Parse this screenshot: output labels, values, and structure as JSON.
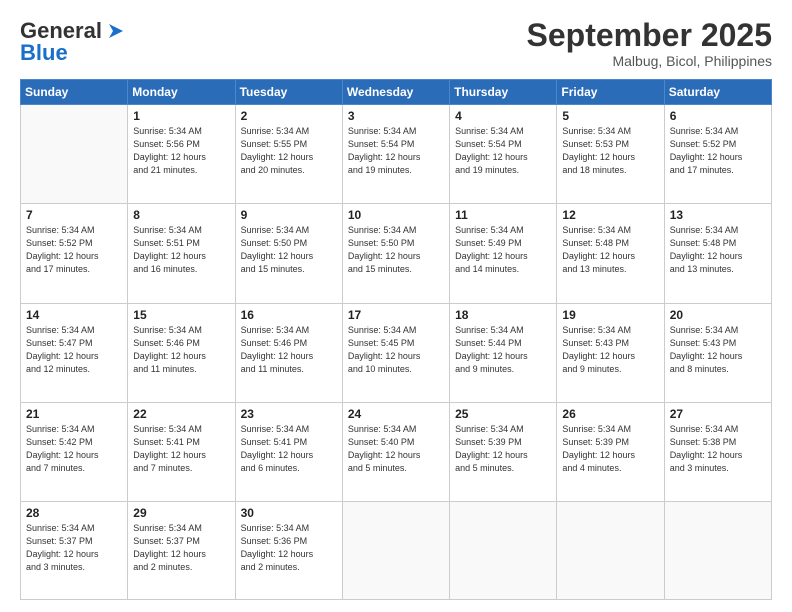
{
  "header": {
    "logo": {
      "general": "General",
      "blue": "Blue"
    },
    "title": "September 2025",
    "location": "Malbug, Bicol, Philippines"
  },
  "weekdays": [
    "Sunday",
    "Monday",
    "Tuesday",
    "Wednesday",
    "Thursday",
    "Friday",
    "Saturday"
  ],
  "weeks": [
    [
      {
        "day": "",
        "info": ""
      },
      {
        "day": "1",
        "info": "Sunrise: 5:34 AM\nSunset: 5:56 PM\nDaylight: 12 hours\nand 21 minutes."
      },
      {
        "day": "2",
        "info": "Sunrise: 5:34 AM\nSunset: 5:55 PM\nDaylight: 12 hours\nand 20 minutes."
      },
      {
        "day": "3",
        "info": "Sunrise: 5:34 AM\nSunset: 5:54 PM\nDaylight: 12 hours\nand 19 minutes."
      },
      {
        "day": "4",
        "info": "Sunrise: 5:34 AM\nSunset: 5:54 PM\nDaylight: 12 hours\nand 19 minutes."
      },
      {
        "day": "5",
        "info": "Sunrise: 5:34 AM\nSunset: 5:53 PM\nDaylight: 12 hours\nand 18 minutes."
      },
      {
        "day": "6",
        "info": "Sunrise: 5:34 AM\nSunset: 5:52 PM\nDaylight: 12 hours\nand 17 minutes."
      }
    ],
    [
      {
        "day": "7",
        "info": "Sunrise: 5:34 AM\nSunset: 5:52 PM\nDaylight: 12 hours\nand 17 minutes."
      },
      {
        "day": "8",
        "info": "Sunrise: 5:34 AM\nSunset: 5:51 PM\nDaylight: 12 hours\nand 16 minutes."
      },
      {
        "day": "9",
        "info": "Sunrise: 5:34 AM\nSunset: 5:50 PM\nDaylight: 12 hours\nand 15 minutes."
      },
      {
        "day": "10",
        "info": "Sunrise: 5:34 AM\nSunset: 5:50 PM\nDaylight: 12 hours\nand 15 minutes."
      },
      {
        "day": "11",
        "info": "Sunrise: 5:34 AM\nSunset: 5:49 PM\nDaylight: 12 hours\nand 14 minutes."
      },
      {
        "day": "12",
        "info": "Sunrise: 5:34 AM\nSunset: 5:48 PM\nDaylight: 12 hours\nand 13 minutes."
      },
      {
        "day": "13",
        "info": "Sunrise: 5:34 AM\nSunset: 5:48 PM\nDaylight: 12 hours\nand 13 minutes."
      }
    ],
    [
      {
        "day": "14",
        "info": "Sunrise: 5:34 AM\nSunset: 5:47 PM\nDaylight: 12 hours\nand 12 minutes."
      },
      {
        "day": "15",
        "info": "Sunrise: 5:34 AM\nSunset: 5:46 PM\nDaylight: 12 hours\nand 11 minutes."
      },
      {
        "day": "16",
        "info": "Sunrise: 5:34 AM\nSunset: 5:46 PM\nDaylight: 12 hours\nand 11 minutes."
      },
      {
        "day": "17",
        "info": "Sunrise: 5:34 AM\nSunset: 5:45 PM\nDaylight: 12 hours\nand 10 minutes."
      },
      {
        "day": "18",
        "info": "Sunrise: 5:34 AM\nSunset: 5:44 PM\nDaylight: 12 hours\nand 9 minutes."
      },
      {
        "day": "19",
        "info": "Sunrise: 5:34 AM\nSunset: 5:43 PM\nDaylight: 12 hours\nand 9 minutes."
      },
      {
        "day": "20",
        "info": "Sunrise: 5:34 AM\nSunset: 5:43 PM\nDaylight: 12 hours\nand 8 minutes."
      }
    ],
    [
      {
        "day": "21",
        "info": "Sunrise: 5:34 AM\nSunset: 5:42 PM\nDaylight: 12 hours\nand 7 minutes."
      },
      {
        "day": "22",
        "info": "Sunrise: 5:34 AM\nSunset: 5:41 PM\nDaylight: 12 hours\nand 7 minutes."
      },
      {
        "day": "23",
        "info": "Sunrise: 5:34 AM\nSunset: 5:41 PM\nDaylight: 12 hours\nand 6 minutes."
      },
      {
        "day": "24",
        "info": "Sunrise: 5:34 AM\nSunset: 5:40 PM\nDaylight: 12 hours\nand 5 minutes."
      },
      {
        "day": "25",
        "info": "Sunrise: 5:34 AM\nSunset: 5:39 PM\nDaylight: 12 hours\nand 5 minutes."
      },
      {
        "day": "26",
        "info": "Sunrise: 5:34 AM\nSunset: 5:39 PM\nDaylight: 12 hours\nand 4 minutes."
      },
      {
        "day": "27",
        "info": "Sunrise: 5:34 AM\nSunset: 5:38 PM\nDaylight: 12 hours\nand 3 minutes."
      }
    ],
    [
      {
        "day": "28",
        "info": "Sunrise: 5:34 AM\nSunset: 5:37 PM\nDaylight: 12 hours\nand 3 minutes."
      },
      {
        "day": "29",
        "info": "Sunrise: 5:34 AM\nSunset: 5:37 PM\nDaylight: 12 hours\nand 2 minutes."
      },
      {
        "day": "30",
        "info": "Sunrise: 5:34 AM\nSunset: 5:36 PM\nDaylight: 12 hours\nand 2 minutes."
      },
      {
        "day": "",
        "info": ""
      },
      {
        "day": "",
        "info": ""
      },
      {
        "day": "",
        "info": ""
      },
      {
        "day": "",
        "info": ""
      }
    ]
  ]
}
